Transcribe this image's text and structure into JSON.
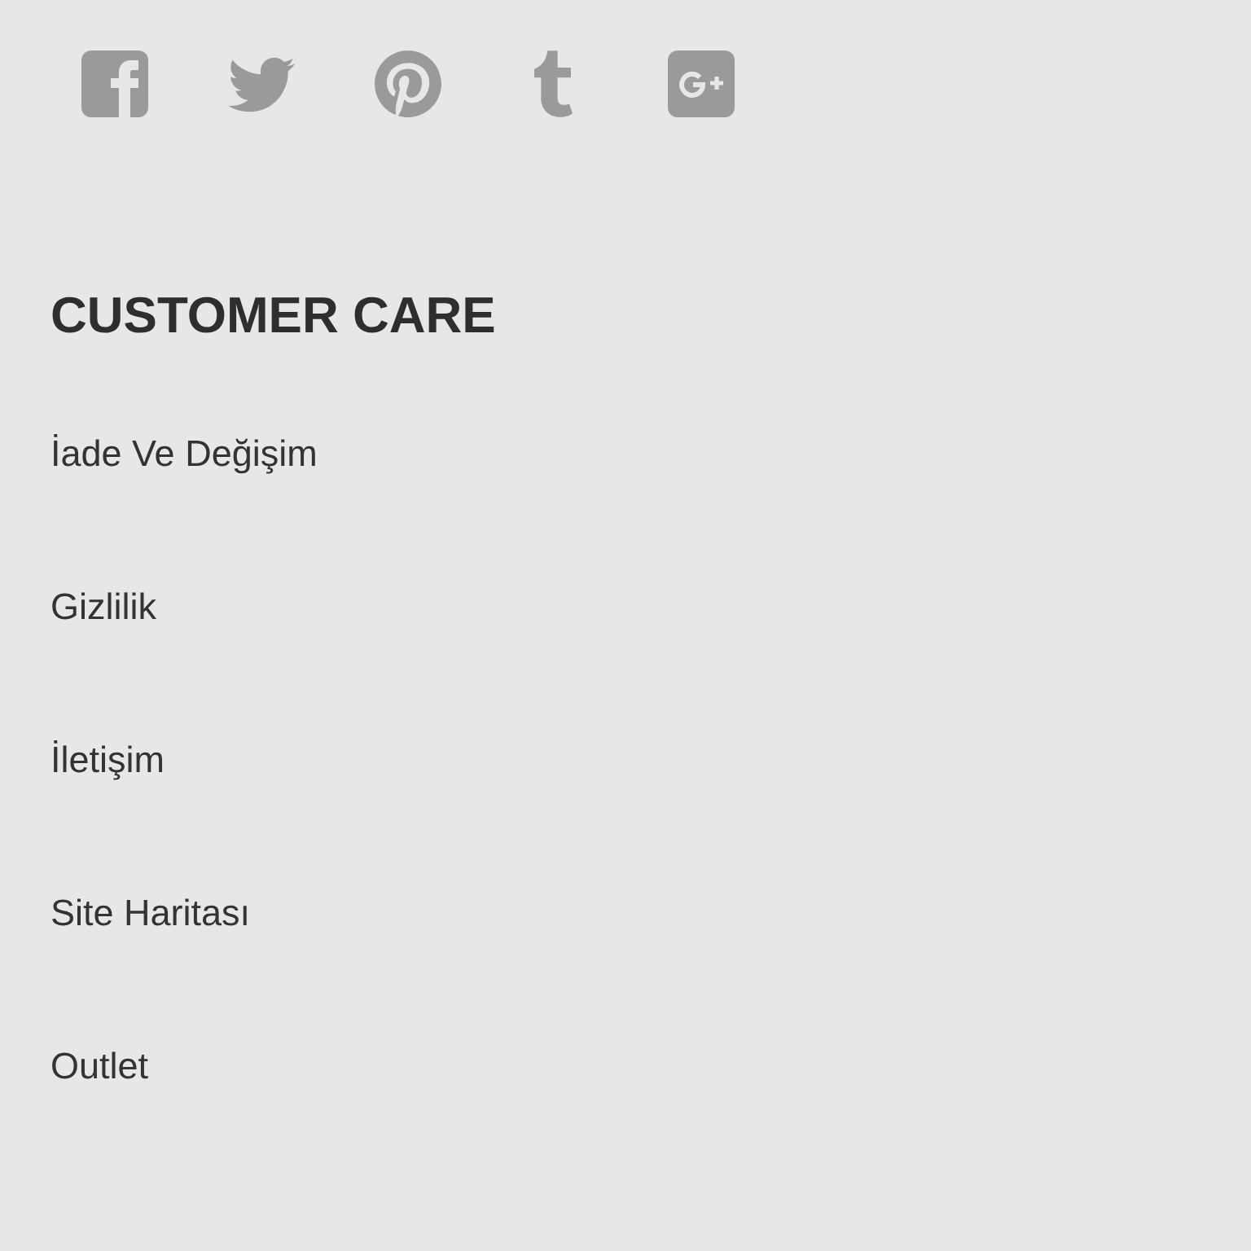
{
  "social_links": [
    {
      "kind": "facebook"
    },
    {
      "kind": "twitter"
    },
    {
      "kind": "pinterest"
    },
    {
      "kind": "tumblr"
    },
    {
      "kind": "google_plus"
    }
  ],
  "customer_care": {
    "title": "CUSTOMER CARE",
    "links": [
      "İade Ve Değişim",
      "Gizlilik",
      "İletişim",
      "Site Haritası",
      "Outlet"
    ]
  }
}
